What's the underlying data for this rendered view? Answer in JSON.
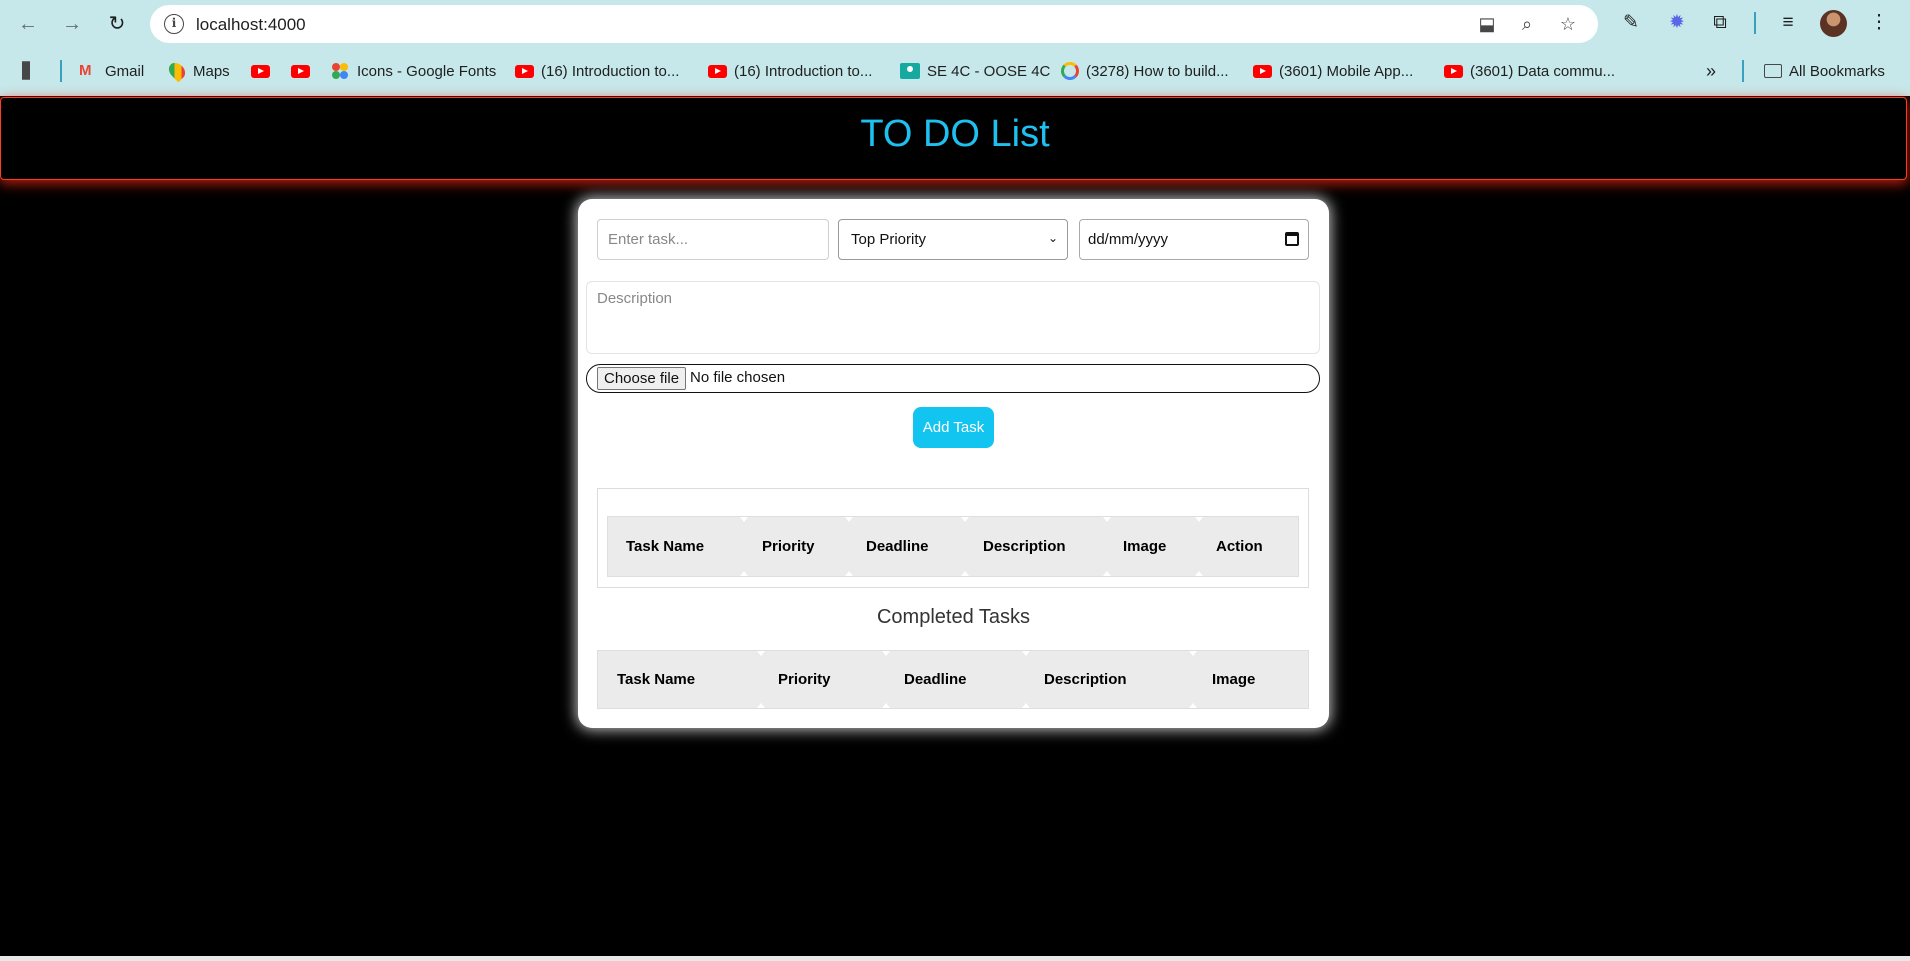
{
  "browser": {
    "url": "localhost:4000",
    "bookmarks": [
      {
        "label": "Gmail",
        "icon": "gmail-icon"
      },
      {
        "label": "Maps",
        "icon": "maps-icon"
      },
      {
        "label": "",
        "icon": "youtube-icon"
      },
      {
        "label": "",
        "icon": "youtube-icon"
      },
      {
        "label": "Icons - Google Fonts",
        "icon": "google-fonts-icon"
      },
      {
        "label": "(16) Introduction to...",
        "icon": "youtube-icon"
      },
      {
        "label": "(16) Introduction to...",
        "icon": "youtube-icon"
      },
      {
        "label": "SE 4C - OOSE 4C",
        "icon": "classroom-icon"
      },
      {
        "label": "(3278) How to build...",
        "icon": "google-icon"
      },
      {
        "label": "(3601) Mobile App...",
        "icon": "youtube-icon"
      },
      {
        "label": "(3601) Data commu...",
        "icon": "youtube-icon"
      }
    ],
    "overflow_label": "»",
    "all_bookmarks": "All Bookmarks"
  },
  "app": {
    "title": "TO DO List",
    "form": {
      "task_placeholder": "Enter task...",
      "priority_value": "Top Priority",
      "date_placeholder": "dd/mm/yyyy",
      "description_placeholder": "Description",
      "file_button": "Choose file",
      "file_status": "No file chosen",
      "add_button": "Add Task"
    },
    "tasks_table": {
      "columns": [
        "Task Name",
        "Priority",
        "Deadline",
        "Description",
        "Image",
        "Action"
      ]
    },
    "completed": {
      "title": "Completed Tasks",
      "columns": [
        "Task Name",
        "Priority",
        "Deadline",
        "Description",
        "Image"
      ]
    }
  },
  "colors": {
    "title": "#1ec0f0",
    "add_button": "#12c4f0",
    "header_glow": "#ff3b1f",
    "chrome": "#c6e8ea"
  }
}
